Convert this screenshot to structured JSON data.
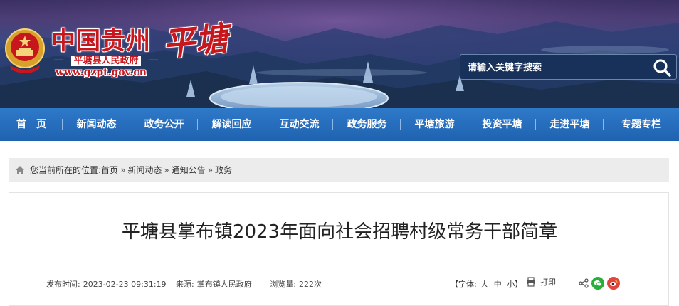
{
  "header": {
    "site_name": "中国贵州",
    "government": "平塘县人民政府",
    "url": "www.gzpt.gov.cn",
    "county_script": "平塘"
  },
  "search": {
    "placeholder": "请输入关键字搜索",
    "icon": "search-icon"
  },
  "nav": {
    "items": [
      {
        "label": "首　页"
      },
      {
        "label": "新闻动态"
      },
      {
        "label": "政务公开"
      },
      {
        "label": "解读回应"
      },
      {
        "label": "互动交流"
      },
      {
        "label": "政务服务"
      },
      {
        "label": "平塘旅游"
      },
      {
        "label": "投资平塘"
      },
      {
        "label": "走进平塘"
      },
      {
        "label": "专题专栏"
      }
    ]
  },
  "breadcrumb": {
    "prefix": "您当前所在的位置:",
    "items": [
      "首页",
      "新闻动态",
      "通知公告",
      "政务"
    ],
    "separator": "»"
  },
  "article": {
    "title": "平塘县掌布镇2023年面向社会招聘村级常务干部简章",
    "publish_label": "发布时间:",
    "publish_time": "2023-02-23 09:31:19",
    "source_label": "来源:",
    "source": "掌布镇人民政府",
    "views_label": "浏览量:",
    "views": "222次",
    "font_label": "【字体:",
    "font_large": "大",
    "font_medium": "中",
    "font_small": "小】",
    "print_label": "打印"
  },
  "colors": {
    "brand_red": "#c8161d",
    "nav_blue": "#2068b6",
    "wechat_green": "#2aae3b",
    "weibo_red": "#e2453c"
  }
}
